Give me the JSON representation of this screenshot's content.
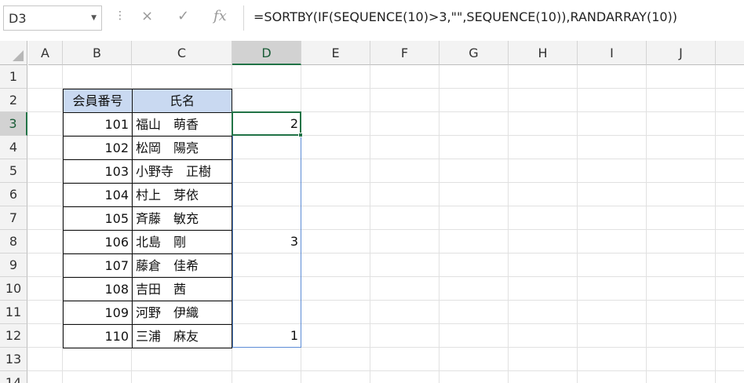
{
  "name_box": "D3",
  "formula_bar": {
    "cancel_icon": "×",
    "enter_icon": "✓",
    "fx_label": "fx",
    "formula": "=SORTBY(IF(SEQUENCE(10)>3,\"\",SEQUENCE(10)),RANDARRAY(10))"
  },
  "columns": [
    "A",
    "B",
    "C",
    "D",
    "E",
    "F",
    "G",
    "H",
    "I",
    "J"
  ],
  "rows": [
    "1",
    "2",
    "3",
    "4",
    "5",
    "6",
    "7",
    "8",
    "9",
    "10",
    "11",
    "12",
    "13",
    "14"
  ],
  "table": {
    "header": [
      "会員番号",
      "氏名"
    ],
    "rows": [
      {
        "id": "101",
        "name": "福山　萌香",
        "d": "2"
      },
      {
        "id": "102",
        "name": "松岡　陽亮",
        "d": ""
      },
      {
        "id": "103",
        "name": "小野寺　正樹",
        "d": ""
      },
      {
        "id": "104",
        "name": "村上　芽依",
        "d": ""
      },
      {
        "id": "105",
        "name": "斉藤　敏充",
        "d": ""
      },
      {
        "id": "106",
        "name": "北島　剛",
        "d": "3"
      },
      {
        "id": "107",
        "name": "藤倉　佳希",
        "d": ""
      },
      {
        "id": "108",
        "name": "吉田　茜",
        "d": ""
      },
      {
        "id": "109",
        "name": "河野　伊織",
        "d": ""
      },
      {
        "id": "110",
        "name": "三浦　麻友",
        "d": "1"
      }
    ]
  },
  "colors": {
    "accent": "#217346",
    "header_fill": "#c9d9f1",
    "spill_border": "#5b8bd6"
  }
}
